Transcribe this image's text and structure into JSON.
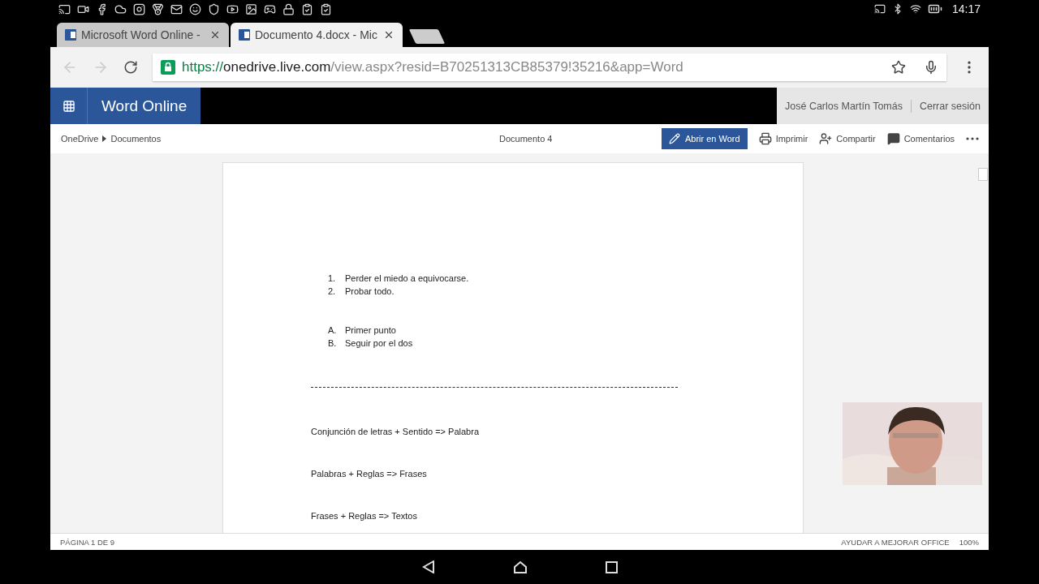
{
  "status_bar": {
    "time": "14:17"
  },
  "tabs": [
    {
      "title": "Microsoft Word Online -",
      "selected": false
    },
    {
      "title": "Documento 4.docx - Mic",
      "selected": true
    }
  ],
  "address_bar": {
    "scheme": "https://",
    "host": "onedrive.live.com",
    "path": "/view.aspx?resid=B70251313CB85379!35216&app=Word"
  },
  "app_bar": {
    "brand": "Word Online",
    "user": "José Carlos Martín Tomás",
    "sign_out": "Cerrar sesión"
  },
  "breadcrumb": [
    "OneDrive",
    "Documentos"
  ],
  "document_title": "Documento 4",
  "actions": [
    {
      "label": "Abrir en Word",
      "kind": "primary"
    },
    {
      "label": "Imprimir",
      "kind": "print"
    },
    {
      "label": "Compartir",
      "kind": "share"
    },
    {
      "label": "Comentarios",
      "kind": "comments"
    }
  ],
  "document": [
    {
      "kind": "list",
      "items": [
        {
          "marker": "1.",
          "text": "Perder el miedo a equivocarse."
        },
        {
          "marker": "2.",
          "text": "Probar todo."
        }
      ]
    },
    {
      "kind": "list",
      "items": [
        {
          "marker": "A.",
          "text": "Primer punto"
        },
        {
          "marker": "B.",
          "text": "Seguir por el dos"
        }
      ]
    },
    {
      "kind": "rule"
    },
    {
      "kind": "paragraph",
      "text": "Conjunción de letras + Sentido => Palabra"
    },
    {
      "kind": "paragraph",
      "text": "Palabras + Reglas => Frases"
    },
    {
      "kind": "paragraph",
      "text": "Frases + Reglas => Textos"
    }
  ],
  "footer": {
    "page": "PÁGINA 1 DE 9",
    "help": "AYUDAR A MEJORAR OFFICE",
    "zoom": "100%"
  }
}
